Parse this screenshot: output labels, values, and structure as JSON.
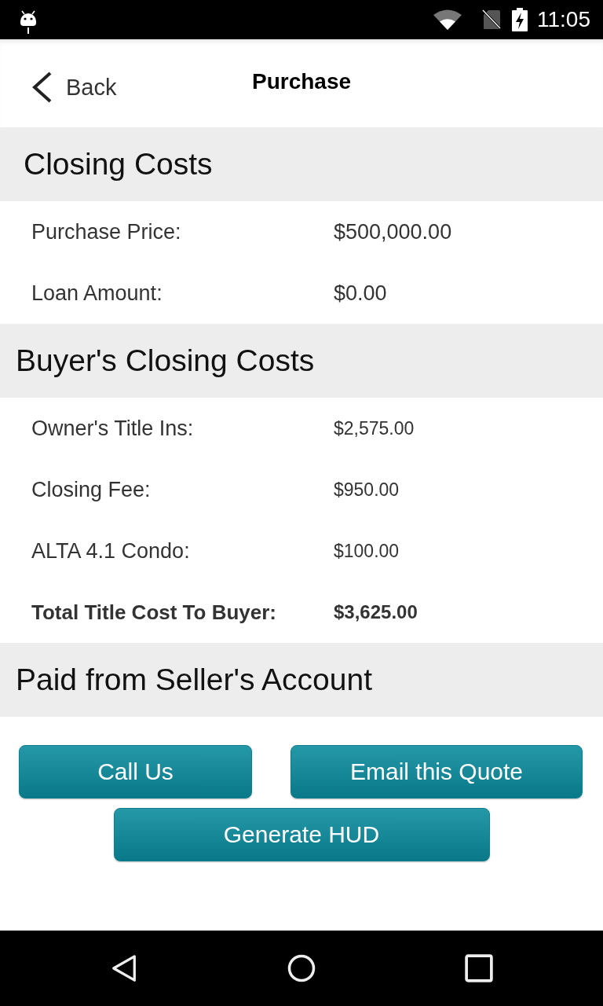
{
  "status_bar": {
    "time": "11:05"
  },
  "header": {
    "back_label": "Back",
    "title": "Purchase"
  },
  "sections": [
    {
      "title": "Closing Costs",
      "kind": "summary",
      "rows": [
        {
          "label": "Purchase Price:",
          "value": "$500,000.00",
          "kind": "item"
        },
        {
          "label": "Loan Amount:",
          "value": "$0.00",
          "kind": "item"
        }
      ]
    },
    {
      "title": "Buyer's Closing Costs",
      "kind": "itemized",
      "rows": [
        {
          "label": "Owner's Title Ins:",
          "value": "$2,575.00",
          "kind": "item"
        },
        {
          "label": "Closing Fee:",
          "value": "$950.00",
          "kind": "item"
        },
        {
          "label": "ALTA 4.1 Condo:",
          "value": "$100.00",
          "kind": "item"
        },
        {
          "label": "Total Title Cost To Buyer:",
          "value": "$3,625.00",
          "kind": "total"
        }
      ]
    },
    {
      "title": "Paid from Seller's Account",
      "kind": "itemized"
    }
  ],
  "button_rows": [
    [
      "Call Us",
      "Email this Quote"
    ],
    [
      "Generate HUD"
    ]
  ]
}
